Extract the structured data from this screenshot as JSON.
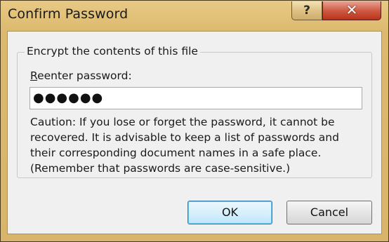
{
  "window": {
    "title": "Confirm Password",
    "help_glyph": "?",
    "close_glyph": "✕"
  },
  "group": {
    "label": "Encrypt the contents of this file"
  },
  "password": {
    "label_mnemonic": "R",
    "label_rest": "eenter password:",
    "masked_value": "●●●●●●"
  },
  "caution": {
    "text": "Caution: If you lose or forget the password, it cannot be\nrecovered. It is advisable to keep a list of passwords and\ntheir corresponding document names in a safe place.\n(Remember that passwords are case-sensitive.)"
  },
  "buttons": {
    "ok_label": "OK",
    "cancel_label": "Cancel"
  },
  "colors": {
    "frame": "#dcb96f",
    "close_button": "#c8452c",
    "client_background": "#f0f0f0",
    "default_button_border": "#3c7fb1"
  },
  "icons": {
    "help": "help-icon",
    "close": "close-icon"
  }
}
